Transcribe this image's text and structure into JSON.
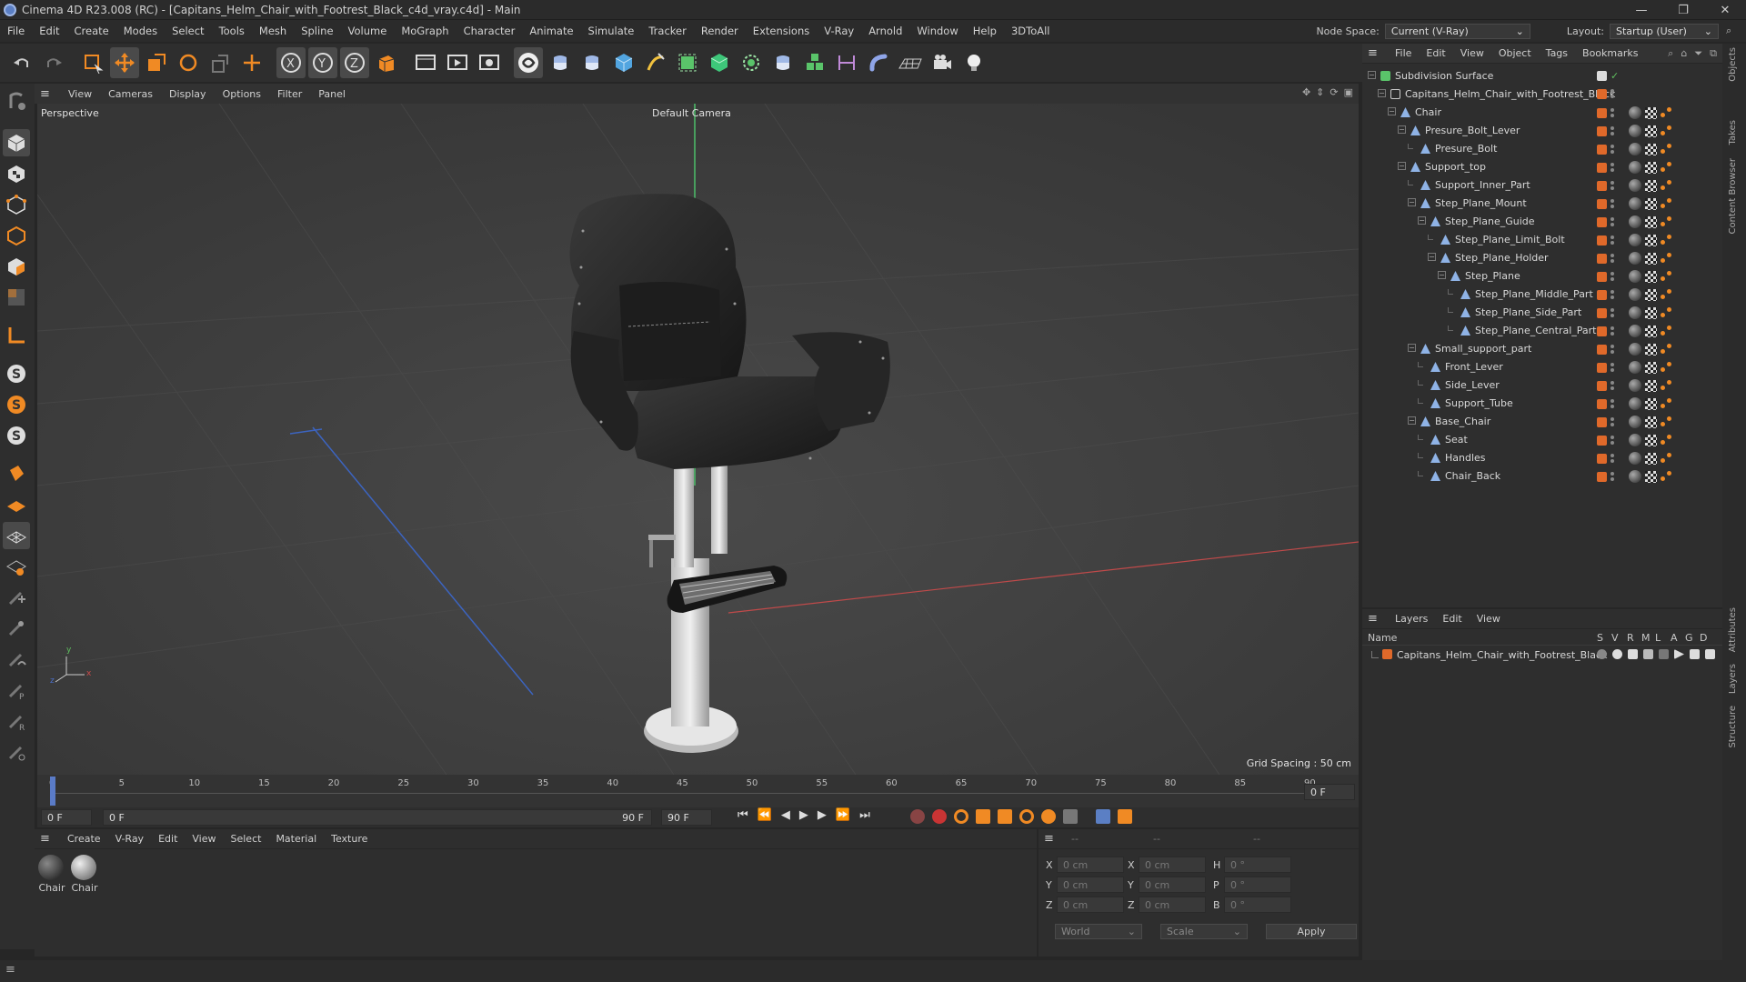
{
  "window": {
    "title": "Cinema 4D R23.008 (RC) - [Capitans_Helm_Chair_with_Footrest_Black_c4d_vray.c4d] - Main",
    "controls": [
      "—",
      "❐",
      "✕"
    ]
  },
  "menu": [
    "File",
    "Edit",
    "Create",
    "Modes",
    "Select",
    "Tools",
    "Mesh",
    "Spline",
    "Volume",
    "MoGraph",
    "Character",
    "Animate",
    "Simulate",
    "Tracker",
    "Render",
    "Extensions",
    "V-Ray",
    "Arnold",
    "Window",
    "Help",
    "3DToAll"
  ],
  "node_space": {
    "label": "Node Space:",
    "value": "Current (V-Ray)"
  },
  "layout": {
    "label": "Layout:",
    "value": "Startup (User)"
  },
  "viewport": {
    "menu": [
      "View",
      "Cameras",
      "Display",
      "Options",
      "Filter",
      "Panel"
    ],
    "name": "Perspective",
    "camera": "Default Camera",
    "grid_spacing": "Grid Spacing : 50 cm"
  },
  "timeline": {
    "ticks": [
      "0",
      "5",
      "10",
      "15",
      "20",
      "25",
      "30",
      "35",
      "40",
      "45",
      "50",
      "55",
      "60",
      "65",
      "70",
      "75",
      "80",
      "85",
      "90"
    ],
    "current": "0 F",
    "start": "0 F",
    "range_start": "0 F",
    "range_end": "90 F",
    "end": "90 F"
  },
  "material_panel": {
    "menu": [
      "Create",
      "V-Ray",
      "Edit",
      "View",
      "Select",
      "Material",
      "Texture"
    ],
    "materials": [
      {
        "name": "Chair"
      },
      {
        "name": "Chair"
      }
    ]
  },
  "coords": {
    "header": [
      "--",
      "--",
      "--"
    ],
    "rows": [
      {
        "a": "X",
        "av": "0 cm",
        "b": "X",
        "bv": "0 cm",
        "c": "H",
        "cv": "0 °"
      },
      {
        "a": "Y",
        "av": "0 cm",
        "b": "Y",
        "bv": "0 cm",
        "c": "P",
        "cv": "0 °"
      },
      {
        "a": "Z",
        "av": "0 cm",
        "b": "Z",
        "bv": "0 cm",
        "c": "B",
        "cv": "0 °"
      }
    ],
    "world": "World",
    "scale": "Scale",
    "apply": "Apply"
  },
  "objects_panel": {
    "menu": [
      "File",
      "Edit",
      "View",
      "Object",
      "Tags",
      "Bookmarks"
    ],
    "items": [
      {
        "name": "Subdivision Surface",
        "depth": 0,
        "type": "subdiv"
      },
      {
        "name": "Capitans_Helm_Chair_with_Footrest_Black",
        "depth": 1,
        "type": "null"
      },
      {
        "name": "Chair",
        "depth": 2,
        "type": "obj"
      },
      {
        "name": "Presure_Bolt_Lever",
        "depth": 3,
        "type": "obj"
      },
      {
        "name": "Presure_Bolt",
        "depth": 4,
        "type": "obj"
      },
      {
        "name": "Support_top",
        "depth": 3,
        "type": "obj"
      },
      {
        "name": "Support_Inner_Part",
        "depth": 4,
        "type": "obj"
      },
      {
        "name": "Step_Plane_Mount",
        "depth": 4,
        "type": "obj"
      },
      {
        "name": "Step_Plane_Guide",
        "depth": 5,
        "type": "obj"
      },
      {
        "name": "Step_Plane_Limit_Bolt",
        "depth": 6,
        "type": "obj"
      },
      {
        "name": "Step_Plane_Holder",
        "depth": 6,
        "type": "obj"
      },
      {
        "name": "Step_Plane",
        "depth": 7,
        "type": "obj"
      },
      {
        "name": "Step_Plane_Middle_Part",
        "depth": 8,
        "type": "obj"
      },
      {
        "name": "Step_Plane_Side_Part",
        "depth": 8,
        "type": "obj"
      },
      {
        "name": "Step_Plane_Central_Part",
        "depth": 8,
        "type": "obj"
      },
      {
        "name": "Small_support_part",
        "depth": 4,
        "type": "obj"
      },
      {
        "name": "Front_Lever",
        "depth": 5,
        "type": "obj"
      },
      {
        "name": "Side_Lever",
        "depth": 5,
        "type": "obj"
      },
      {
        "name": "Support_Tube",
        "depth": 5,
        "type": "obj"
      },
      {
        "name": "Base_Chair",
        "depth": 4,
        "type": "obj"
      },
      {
        "name": "Seat",
        "depth": 5,
        "type": "obj"
      },
      {
        "name": "Handles",
        "depth": 5,
        "type": "obj"
      },
      {
        "name": "Chair_Back",
        "depth": 5,
        "type": "obj"
      }
    ]
  },
  "layers_panel": {
    "menu": [
      "Layers",
      "Edit",
      "View"
    ],
    "columns": [
      "Name",
      "S",
      "V",
      "R",
      "M",
      "L",
      "A",
      "G",
      "D"
    ],
    "layers": [
      {
        "name": "Capitans_Helm_Chair_with_Footrest_Black",
        "color": "#e0692a"
      }
    ]
  },
  "right_tabs": [
    "Objects",
    "Takes",
    "Content Browser",
    "Attributes",
    "Layers",
    "Structure"
  ],
  "colors": {
    "accent": "#f08a24",
    "layer": "#e0692a",
    "x_axis": "#c94a4a",
    "y_axis": "#5fbf5f",
    "z_axis": "#4a6fc9"
  }
}
